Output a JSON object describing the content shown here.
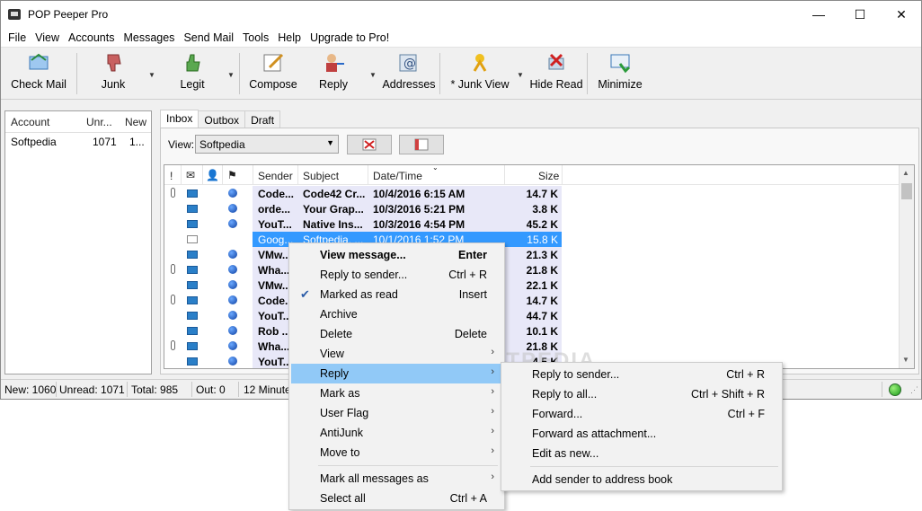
{
  "window": {
    "title": "POP Peeper Pro"
  },
  "menubar": [
    "File",
    "View",
    "Accounts",
    "Messages",
    "Send Mail",
    "Tools",
    "Help",
    "Upgrade to Pro!"
  ],
  "toolbar": {
    "check_mail": "Check Mail",
    "junk": "Junk",
    "legit": "Legit",
    "compose": "Compose",
    "reply": "Reply",
    "addresses": "Addresses",
    "junk_view": "* Junk View",
    "hide_read": "Hide Read",
    "minimize": "Minimize"
  },
  "accounts": {
    "headers": [
      "Account",
      "Unr...",
      "New"
    ],
    "rows": [
      {
        "name": "Softpedia",
        "unread": "1071",
        "new": "1..."
      }
    ]
  },
  "tabs": [
    "Inbox",
    "Outbox",
    "Draft"
  ],
  "view": {
    "label": "View:",
    "value": "Softpedia"
  },
  "messages": {
    "headers": {
      "flag": "!",
      "sender": "Sender",
      "subject": "Subject",
      "date": "Date/Time",
      "size": "Size"
    },
    "rows": [
      {
        "sender": "Code...",
        "subject": "Code42 Cr...",
        "date": "10/4/2016 6:15 AM",
        "size": "14.7 K"
      },
      {
        "sender": "orde...",
        "subject": "Your Grap...",
        "date": "10/3/2016 5:21 PM",
        "size": "3.8 K"
      },
      {
        "sender": "YouT...",
        "subject": "Native Ins...",
        "date": "10/3/2016 4:54 PM",
        "size": "45.2 K"
      },
      {
        "sender": "Goog...",
        "subject": "Softpedia, ...",
        "date": "10/1/2016 1:52 PM",
        "size": "15.8 K"
      },
      {
        "sender": "VMw...",
        "subject": "",
        "date": "",
        "size": "21.3 K"
      },
      {
        "sender": "Wha...",
        "subject": "",
        "date": "",
        "size": "21.8 K"
      },
      {
        "sender": "VMw...",
        "subject": "",
        "date": "",
        "size": "22.1 K"
      },
      {
        "sender": "Code...",
        "subject": "",
        "date": "",
        "size": "14.7 K"
      },
      {
        "sender": "YouT...",
        "subject": "",
        "date": "",
        "size": "44.7 K"
      },
      {
        "sender": "Rob ...",
        "subject": "",
        "date": "",
        "size": "10.1 K"
      },
      {
        "sender": "Wha...",
        "subject": "",
        "date": "",
        "size": "21.8 K"
      },
      {
        "sender": "YouT...",
        "subject": "",
        "date": "",
        "size": "4.5 K"
      }
    ]
  },
  "statusbar": {
    "new": "New: 1060",
    "unread": "Unread: 1071",
    "total": "Total: 985",
    "out": "Out: 0",
    "timer": "12 Minute"
  },
  "context_menu": {
    "view_message": "View message...",
    "view_message_sc": "Enter",
    "reply_sender": "Reply to sender...",
    "reply_sender_sc": "Ctrl + R",
    "marked_read": "Marked as read",
    "marked_read_sc": "Insert",
    "archive": "Archive",
    "delete": "Delete",
    "delete_sc": "Delete",
    "view": "View",
    "reply": "Reply",
    "mark_as": "Mark as",
    "user_flag": "User Flag",
    "antijunk": "AntiJunk",
    "move_to": "Move to",
    "mark_all": "Mark all messages as",
    "select_all": "Select all",
    "select_all_sc": "Ctrl + A"
  },
  "reply_submenu": {
    "reply_sender": "Reply to sender...",
    "reply_sender_sc": "Ctrl + R",
    "reply_all": "Reply to all...",
    "reply_all_sc": "Ctrl + Shift + R",
    "forward": "Forward...",
    "forward_sc": "Ctrl + F",
    "forward_attach": "Forward as attachment...",
    "edit_new": "Edit as new...",
    "add_sender": "Add sender to address book"
  },
  "colors": {
    "selection": "#3399ff",
    "menu_highlight": "#91c9f7",
    "unread_shade": "#e8e8f8"
  }
}
